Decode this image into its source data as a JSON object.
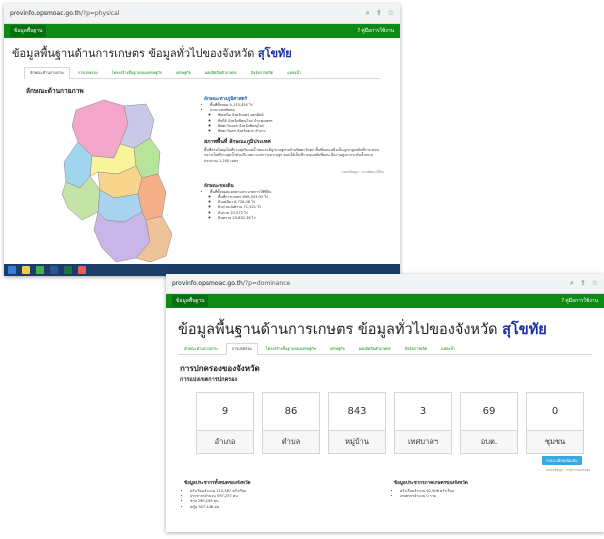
{
  "window1": {
    "url_domain": "provinfo.opsmoac.go.th",
    "url_path": "/?p=physical",
    "nav_brand": "ข้อมูลพื้นฐาน",
    "help_label": "คู่มือการใช้งาน",
    "title_prefix": "ข้อมูลพื้นฐานด้านการเกษตร ข้อมูลทั่วไปของจังหวัด",
    "province": "สุโขทัย",
    "tabs": [
      {
        "label": "ลักษณะด้านกายภาพ"
      },
      {
        "label": "การปกครอง"
      },
      {
        "label": "โครงสร้างพื้นฐานของเศรษฐกิจ"
      },
      {
        "label": "เศรษฐกิจ"
      },
      {
        "label": "ผลผลิตสินค้าเกษตร"
      },
      {
        "label": "ปัจจัยการผลิต"
      },
      {
        "label": "แหล่งน้ำ"
      }
    ],
    "section_title": "ลักษณะด้านกายภาพ",
    "geo_head": "ลักษณะทางภูมิศาสตร์",
    "geo_items": [
      "พื้นที่ทั้งหมด 4,133,435 ไร่",
      "อาณาเขตติดต่อ",
      "ทิศเหนือ จังหวัดแพร่ อุตรดิตถ์",
      "ทิศใต้ จังหวัดพิษณุโลก กำแพงเพชร",
      "ทิศตะวันออก จังหวัดพิษณุโลก",
      "ทิศตะวันตก จังหวัดตาก ลำปาง"
    ],
    "terrain_head": "สภาพพื้นที่ ลักษณะภูมิประเทศ",
    "terrain_text": "พื้นที่ส่วนใหญ่เป็นที่ราบลุ่มริมแม่น้ำยมและมีภูเขาอยู่ทางด้านทิศตะวันตก พื้นที่ตอนเหนือเป็นภูเขาสูงสลับที่ราบ ตอนกลางเป็นที่ราบลุ่มน้ำท่วมถึง เหมาะแก่การเพาะปลูก ตอนใต้เป็นที่ราบลุ่มสลับที่ดอน มีความสูงจากระดับน้ำทะเลประมาณ 1,200 เมตร",
    "soil_head": "ลักษณะของดิน",
    "soil_items": [
      "พื้นที่ทั้งหมดแยกตามประเภทการใช้ที่ดิน",
      "พื้นที่การเกษตร 806,543.93 ไร่",
      "ดินเหนียว 6,728.08 ไร่",
      "ดินร่วนปนทราย 71,521 ไร่",
      "ดินร่วน 20,572 ไร่",
      "ดินทราย 23,832.36 ไร่"
    ],
    "source_note": "แหล่งข้อมูล : กรมพัฒนาที่ดิน"
  },
  "window2": {
    "url_domain": "provinfo.opsmoac.go.th",
    "url_path": "/?p=dominance",
    "nav_brand": "ข้อมูลพื้นฐาน",
    "help_label": "คู่มือการใช้งาน",
    "title_prefix": "ข้อมูลพื้นฐานด้านการเกษตร ข้อมูลทั่วไปของจังหวัด",
    "province": "สุโขทัย",
    "tabs": [
      {
        "label": "ลักษณะด้านกายภาพ"
      },
      {
        "label": "การปกครอง"
      },
      {
        "label": "โครงสร้างพื้นฐานของเศรษฐกิจ"
      },
      {
        "label": "เศรษฐกิจ"
      },
      {
        "label": "ผลผลิตสินค้าเกษตร"
      },
      {
        "label": "ปัจจัยการผลิต"
      },
      {
        "label": "แหล่งน้ำ"
      }
    ],
    "section_title": "การปกครองของจังหวัด",
    "subsection_title": "การแบ่งเขตการปกครอง",
    "stats": [
      {
        "value": "9",
        "label": "อำเภอ"
      },
      {
        "value": "86",
        "label": "ตำบล"
      },
      {
        "value": "843",
        "label": "หมู่บ้าน"
      },
      {
        "value": "3",
        "label": "เทศบาลฯ"
      },
      {
        "value": "69",
        "label": "อบต."
      },
      {
        "value": "0",
        "label": "ชุมชน"
      }
    ],
    "more_button": "รายละเอียดเพิ่มเติม",
    "update_note": "แหล่งข้อมูล : กรมการปกครอง",
    "pop_head": "ข้อมูลประชากรทั้งหมดของจังหวัด",
    "pop_items": [
      "ครัวเรือนจำนวน 215,587 ครัวเรือน",
      "ประชากรจำนวน 597,257 คน",
      "ชาย 290,109 คน",
      "หญิง 307,148 คน"
    ],
    "agr_head": "ข้อมูลประชากรภาคเกษตรของจังหวัด",
    "agr_items": [
      "ครัวเรือนจำนวน 92,906 ครัวเรือน",
      "เกษตรกรจำนวน 0 ราย"
    ]
  },
  "colors": {
    "green": "#0e8a16",
    "blue_title": "#1a2ea0",
    "button": "#3aa7e0"
  }
}
